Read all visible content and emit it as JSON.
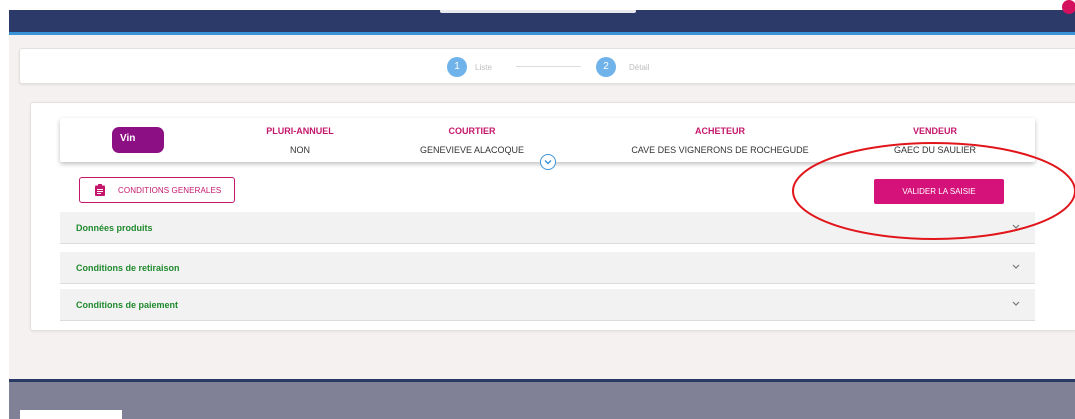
{
  "stepper": {
    "steps": [
      {
        "number": "1",
        "label": "Liste"
      },
      {
        "number": "2",
        "label": "Détail"
      }
    ]
  },
  "contract": {
    "type_badge": "Vin",
    "columns": [
      {
        "header": "PLURI-ANNUEL",
        "value": "NON"
      },
      {
        "header": "COURTIER",
        "value": "GENEVIEVE ALACOQUE"
      },
      {
        "header": "ACHETEUR",
        "value": "CAVE DES VIGNERONS DE ROCHEGUDE"
      },
      {
        "header": "VENDEUR",
        "value": "GAEC DU SAULIER"
      }
    ]
  },
  "actions": {
    "conditions_label": "CONDITIONS GENERALES",
    "validate_label": "VALIDER LA SAISIE"
  },
  "accordions": [
    {
      "label": "Données produits"
    },
    {
      "label": "Conditions de retiraison"
    },
    {
      "label": "Conditions de paiement"
    }
  ],
  "icons": {
    "expand": "chevron-down-icon",
    "conditions": "clipboard-icon",
    "accordion": "chevron-down-icon"
  },
  "colors": {
    "header_bg": "#2b3a68",
    "accent_blue": "#3a92d8",
    "brand_magenta": "#c4176b",
    "button_pink": "#d4127a",
    "badge_purple": "#8c0f84",
    "section_green": "#1f8a2d",
    "annotation_red": "#e0161b"
  }
}
